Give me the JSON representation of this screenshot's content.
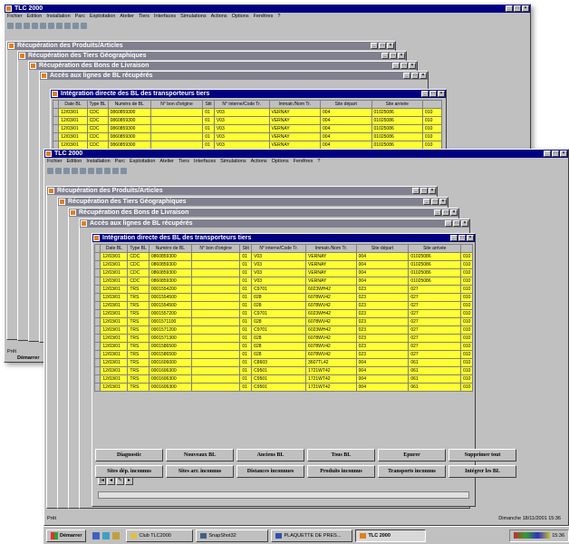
{
  "app": {
    "title": "TLC 2000"
  },
  "menu": [
    "Fichier",
    "Edition",
    "Installation",
    "Parc",
    "Exploitation",
    "Atelier",
    "Tiers",
    "Interfaces",
    "Simulations",
    "Actions",
    "Options",
    "Fenêtres",
    "?"
  ],
  "subwindows": [
    "Récupération des Produits/Articles",
    "Récupération des Tiers Géographiques",
    "Récupération des Bons de Livraison",
    "Accès aux lignes de BL récupérés",
    "Intégration directe des BL des transporteurs tiers"
  ],
  "columns": [
    "Date BL",
    "Type BL",
    "Numéro de BL",
    "N° bon d'origine",
    "Stit",
    "N° interne/Code Tr.",
    "Immatr./Nom Tr.",
    "Site départ",
    "Site arrivée"
  ],
  "rows_back": [
    [
      "12/03/01",
      "CDC",
      "0860859300",
      "",
      "01",
      "V03",
      "VERNAY",
      "004",
      "01025086",
      "010"
    ],
    [
      "12/03/01",
      "CDC",
      "0860859300",
      "",
      "01",
      "V03",
      "VERNAY",
      "004",
      "01025086",
      "010"
    ],
    [
      "12/03/01",
      "CDC",
      "0860859300",
      "",
      "01",
      "V03",
      "VERNAY",
      "004",
      "01025086",
      "010"
    ],
    [
      "12/03/01",
      "CDC",
      "0860859300",
      "",
      "01",
      "V03",
      "VERNAY",
      "004",
      "01025086",
      "010"
    ],
    [
      "12/03/01",
      "CDC",
      "0860859300",
      "",
      "01",
      "V03",
      "VERNAY",
      "004",
      "01025086",
      "010"
    ]
  ],
  "rows": [
    [
      "12/03/01",
      "CDC",
      "0860859300",
      "",
      "01",
      "V03",
      "VERNAY",
      "004",
      "01025086",
      "010"
    ],
    [
      "12/03/01",
      "CDC",
      "0860859300",
      "",
      "01",
      "V03",
      "VERNAY",
      "004",
      "01025086",
      "010"
    ],
    [
      "12/03/01",
      "CDC",
      "0860859300",
      "",
      "01",
      "V03",
      "VERNAY",
      "004",
      "01025086",
      "010"
    ],
    [
      "12/03/01",
      "CDC",
      "0860859300",
      "",
      "01",
      "V03",
      "VERNAY",
      "004",
      "01025086",
      "010"
    ],
    [
      "12/03/01",
      "TRS",
      "0001554200",
      "",
      "01",
      "C9701",
      "6023WH42",
      "023",
      "027",
      "010"
    ],
    [
      "12/03/01",
      "TRS",
      "0001554500",
      "",
      "01",
      "028",
      "6078WV42",
      "023",
      "027",
      "010"
    ],
    [
      "12/03/01",
      "TRS",
      "0001554500",
      "",
      "01",
      "028",
      "6078WV42",
      "023",
      "027",
      "010"
    ],
    [
      "12/03/01",
      "TRS",
      "0001557200",
      "",
      "01",
      "C9701",
      "6023WH42",
      "023",
      "027",
      "010"
    ],
    [
      "12/03/01",
      "TRS",
      "0001571100",
      "",
      "01",
      "028",
      "6078WV42",
      "023",
      "027",
      "010"
    ],
    [
      "12/03/01",
      "TRS",
      "0001571200",
      "",
      "01",
      "C9701",
      "6023WH42",
      "023",
      "027",
      "010"
    ],
    [
      "12/03/01",
      "TRS",
      "0001571300",
      "",
      "01",
      "028",
      "6078WV42",
      "023",
      "027",
      "010"
    ],
    [
      "12/03/01",
      "TRS",
      "0001586500",
      "",
      "01",
      "028",
      "6078WV42",
      "023",
      "027",
      "010"
    ],
    [
      "12/03/01",
      "TRS",
      "0001586500",
      "",
      "01",
      "028",
      "6078WV42",
      "023",
      "027",
      "010"
    ],
    [
      "12/03/01",
      "TRS",
      "0001606000",
      "",
      "01",
      "C8603",
      "3607TL42",
      "004",
      "061",
      "010"
    ],
    [
      "12/03/01",
      "TRS",
      "0001606300",
      "",
      "01",
      "C9501",
      "1721WT42",
      "004",
      "061",
      "010"
    ],
    [
      "12/03/01",
      "TRS",
      "0001606300",
      "",
      "01",
      "C9501",
      "1721WT42",
      "004",
      "061",
      "010"
    ],
    [
      "12/03/01",
      "TRS",
      "0001606300",
      "",
      "01",
      "C9501",
      "1721WT42",
      "004",
      "061",
      "010"
    ]
  ],
  "buttons": [
    [
      "Diagnostic",
      "Nouveaux BL",
      "Anciens BL",
      "Tous BL",
      "Epurer",
      "Supprimer tout"
    ],
    [
      "Sites dép. inconnus",
      "Sites arr. inconnus",
      "Distances inconnues",
      "Produits inconnus",
      "Transports inconnus",
      "Intégrer les BL"
    ]
  ],
  "status": {
    "left": "Prêt",
    "right": "Dimanche 18/11/2001 15:36"
  },
  "back_status": {
    "left": "Prêt"
  },
  "back_taskbar": {
    "start": "Démarrer"
  },
  "taskbar": {
    "start": "Démarrer",
    "items": [
      "Club TLC2000",
      "SnapShot32",
      "PLAQUETTE DE PRES...",
      "TLC 2000"
    ],
    "clock": "15:36"
  }
}
